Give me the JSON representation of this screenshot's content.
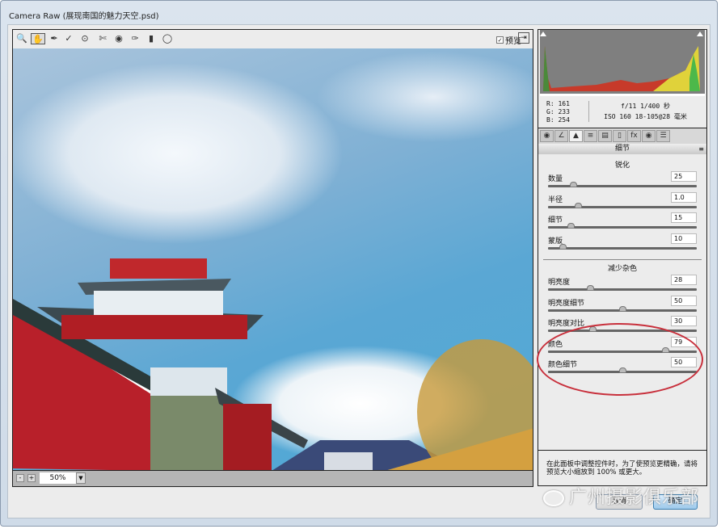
{
  "window": {
    "title": "Camera Raw (展现南国的魅力天空.psd)"
  },
  "toolbar": {
    "tools": [
      "zoom-icon",
      "hand-icon",
      "white-balance-icon",
      "color-sampler-icon",
      "targeted-adjust-icon",
      "crop-icon",
      "straighten-icon",
      "spot-removal-icon",
      "red-eye-icon",
      "adjustment-brush-icon",
      "graduated-filter-icon",
      "rotate-icon"
    ],
    "preview_label": "预览",
    "preview_checked": true
  },
  "zoom": {
    "value": "50%",
    "minus": "-",
    "plus": "+"
  },
  "info": {
    "r": "R:  161",
    "g": "G:  233",
    "b": "B:  254",
    "aperture_shutter": "f/11  1/400 秒",
    "iso_lens": "ISO 160  18-105@28 毫米"
  },
  "panel": {
    "title": "细节",
    "tabs": [
      "basic",
      "tone-curve",
      "detail",
      "hsl",
      "split-toning",
      "lens",
      "fx",
      "camera-calibration",
      "presets"
    ],
    "active_tab": 2,
    "sharpening": {
      "heading": "锐化",
      "rows": [
        {
          "label": "数量",
          "value": "25",
          "fraction": 0.17
        },
        {
          "label": "半径",
          "value": "1.0",
          "fraction": 0.2
        },
        {
          "label": "细节",
          "value": "15",
          "fraction": 0.15
        },
        {
          "label": "蒙版",
          "value": "10",
          "fraction": 0.1
        }
      ]
    },
    "noise": {
      "heading": "减少杂色",
      "rows": [
        {
          "label": "明亮度",
          "value": "28",
          "fraction": 0.28
        },
        {
          "label": "明亮度细节",
          "value": "50",
          "fraction": 0.5
        },
        {
          "label": "明亮度对比",
          "value": "30",
          "fraction": 0.3
        },
        {
          "label": "颜色",
          "value": "79",
          "fraction": 0.79
        },
        {
          "label": "颜色细节",
          "value": "50",
          "fraction": 0.5
        }
      ]
    },
    "help": "在此面板中调整控件时，为了使预览更精确，请将预览大小缩放到 100% 或更大。"
  },
  "buttons": {
    "cancel": "取消",
    "ok": "确定"
  },
  "watermark": "广州摄影俱乐部",
  "colors": {
    "annotation": "#c8303c"
  }
}
